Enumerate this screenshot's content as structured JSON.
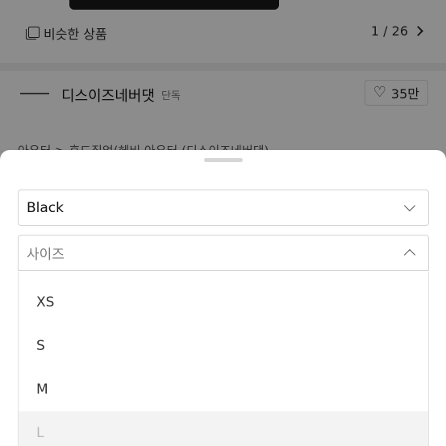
{
  "similar": {
    "label": "비슷한 상품",
    "counter": "1 / 26"
  },
  "seller": {
    "name": "디스이즈네버댓",
    "tag": "단독",
    "likes": "35만"
  },
  "breadcrumb": "아우터 > 후드집업(헤비 아우터 (디스이즈네버댓)",
  "sheet": {
    "color_select": {
      "value": "Black"
    },
    "size_select": {
      "placeholder": "사이즈"
    },
    "size_options": [
      {
        "label": "XS",
        "state": "available"
      },
      {
        "label": "S",
        "state": "available"
      },
      {
        "label": "M",
        "state": "available"
      },
      {
        "label": "L",
        "state": "disabled"
      }
    ]
  }
}
